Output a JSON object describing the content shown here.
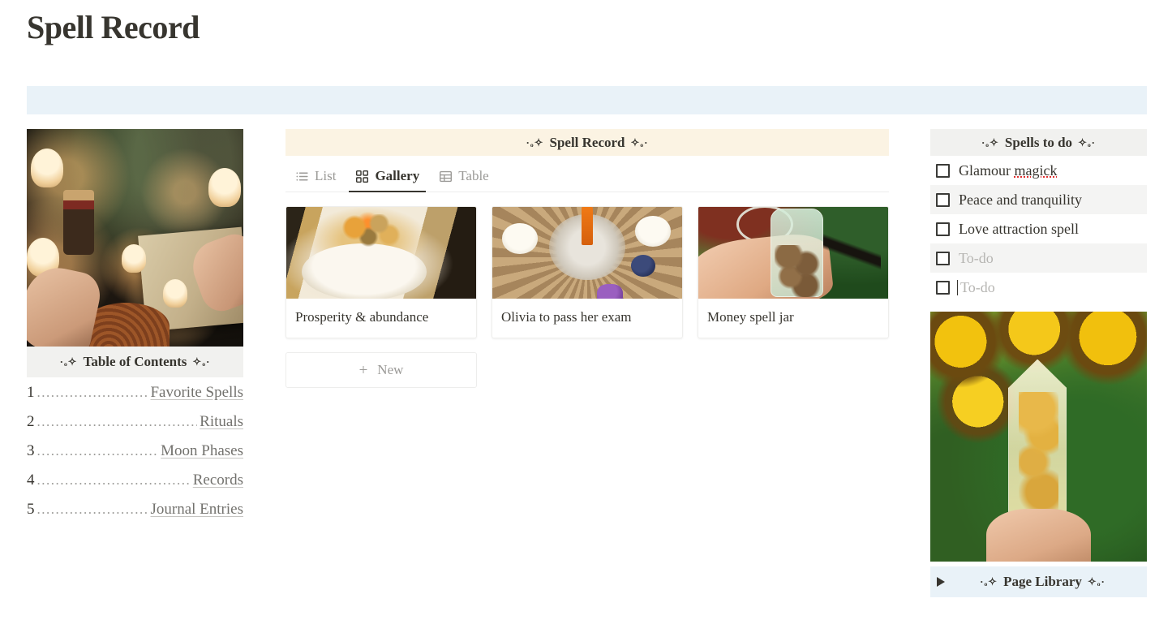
{
  "page": {
    "title": "Spell Record",
    "ornament_left": "·ₒ✧",
    "ornament_right": "✧ₒ·"
  },
  "callout": {
    "text": ""
  },
  "left": {
    "altar_image_alt": "witch altar with candles, bottles, herbs and grimoire",
    "toc": {
      "heading": "Table of Contents",
      "entries": [
        {
          "number": "1",
          "dots": "..................................................",
          "label": "Favorite Spells"
        },
        {
          "number": "2",
          "dots": "..................................................",
          "label": "Rituals"
        },
        {
          "number": "3",
          "dots": "..................................................",
          "label": "Moon Phases"
        },
        {
          "number": "4",
          "dots": "..................................................",
          "label": "Records"
        },
        {
          "number": "5",
          "dots": "..................................................",
          "label": "Journal Entries"
        }
      ]
    }
  },
  "database": {
    "heading": "Spell Record",
    "tabs": [
      {
        "label": "List",
        "icon": "list-icon",
        "active": false
      },
      {
        "label": "Gallery",
        "icon": "gallery-grid-icon",
        "active": true
      },
      {
        "label": "Table",
        "icon": "table-icon",
        "active": false
      }
    ],
    "cards": [
      {
        "label": "Prosperity & abundance",
        "image_alt": "candle in glass with herbs on gold plate"
      },
      {
        "label": "Olivia to pass her exam",
        "image_alt": "spell candle and crystals on woven mat"
      },
      {
        "label": "Money spell jar",
        "image_alt": "hand holding glass spell jar with pentacle charm"
      }
    ],
    "new_button": {
      "label": "New",
      "icon": "plus-icon"
    }
  },
  "right": {
    "todo": {
      "heading": "Spells to do",
      "items": [
        {
          "label": "Glamour magick",
          "checked": false,
          "placeholder": false,
          "misspelled_word": "magick"
        },
        {
          "label": "Peace and tranquility",
          "checked": false,
          "placeholder": false
        },
        {
          "label": "Love attraction spell",
          "checked": false,
          "placeholder": false
        },
        {
          "label": "To-do",
          "checked": false,
          "placeholder": true
        },
        {
          "label": "To-do",
          "checked": false,
          "placeholder": true,
          "caret": true
        }
      ]
    },
    "crystal_image_alt": "hand holding citrine crystal point in front of sunflowers",
    "page_library": {
      "label": "Page Library",
      "toggle_icon": "triangle-right-icon",
      "expanded": false
    }
  },
  "colors": {
    "text": "#37352f",
    "muted": "#9b9a97",
    "blue_callout": "#e9f2f8",
    "cream_header": "#fbf3e3",
    "grey_header": "#f1f1ef",
    "row_shade": "#f4f4f3",
    "spellcheck_red": "#e03030"
  }
}
